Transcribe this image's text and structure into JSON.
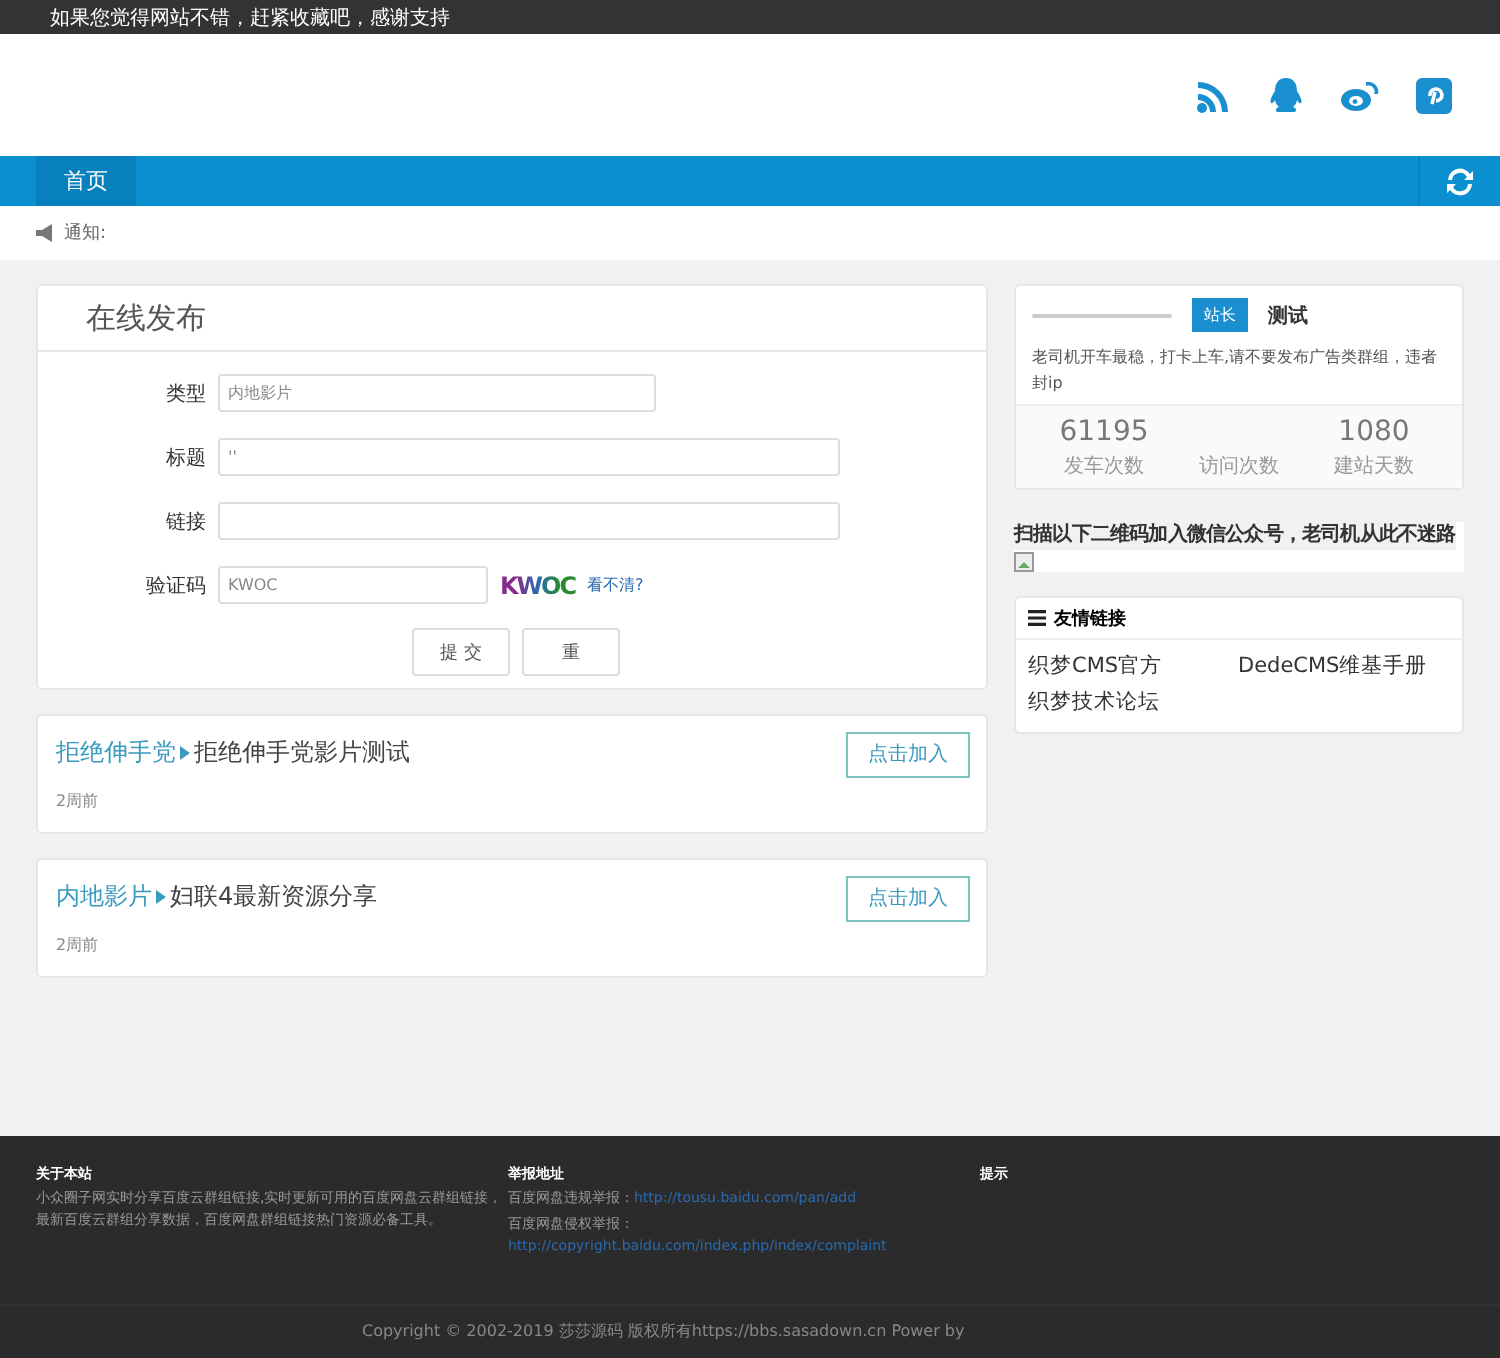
{
  "top_bar": {
    "text": "如果您觉得网站不错，赶紧收藏吧，感谢支持"
  },
  "nav": {
    "items": [
      {
        "label": "首页",
        "selected": true
      }
    ]
  },
  "notice": {
    "label": "通知:"
  },
  "publish_form": {
    "title": "在线发布",
    "fields": [
      {
        "label": "类型",
        "value": "内地影片"
      },
      {
        "label": "标题",
        "value": "''"
      },
      {
        "label": "链接"
      }
    ],
    "captcha": {
      "label": "验证码",
      "value": "KWOC",
      "image_text": "KWOC",
      "refresh_link": "看不清?"
    },
    "buttons": [
      "提 交",
      "重"
    ]
  },
  "posts": [
    {
      "category": "拒绝伸手党",
      "title": "拒绝伸手党影片测试",
      "time": "2周前",
      "button": "点击加入"
    },
    {
      "category": "内地影片",
      "title": "妇联4最新资源分享",
      "time": "2周前",
      "button": "点击加入"
    }
  ],
  "profile": {
    "badge": "站长",
    "name": "测试",
    "description": "老司机开车最稳，打卡上车,请不要发布广告类群组，违者封ip",
    "stats": [
      {
        "value": "61195",
        "label": "发车次数"
      },
      {
        "label": "访问次数"
      },
      {
        "value": "1080",
        "label": "建站天数"
      }
    ]
  },
  "qr_notice": "扫描以下二维码加入微信公众号，老司机从此不迷路",
  "links": {
    "title": "友情链接",
    "items": [
      "织梦CMS官方",
      "DedeCMS维基手册",
      "织梦技术论坛"
    ]
  },
  "footer": {
    "columns": [
      {
        "heading": "关于本站",
        "text": "小众圈子网实时分享百度云群组链接,实时更新可用的百度网盘云群组链接，最新百度云群组分享数据，百度网盘群组链接热门资源必备工具。"
      },
      {
        "heading": "举报地址",
        "lines": [
          {
            "label": "百度网盘违规举报：",
            "link": "http://tousu.baidu.com/pan/add"
          },
          {
            "label": "百度网盘侵权举报：",
            "link": "http://copyright.baidu.com/index.php/index/complaint"
          }
        ]
      },
      {
        "heading": "提示"
      }
    ],
    "copyright": "Copyright © 2002-2019 莎莎源码 版权所有https://bbs.sasadown.cn Power by"
  }
}
